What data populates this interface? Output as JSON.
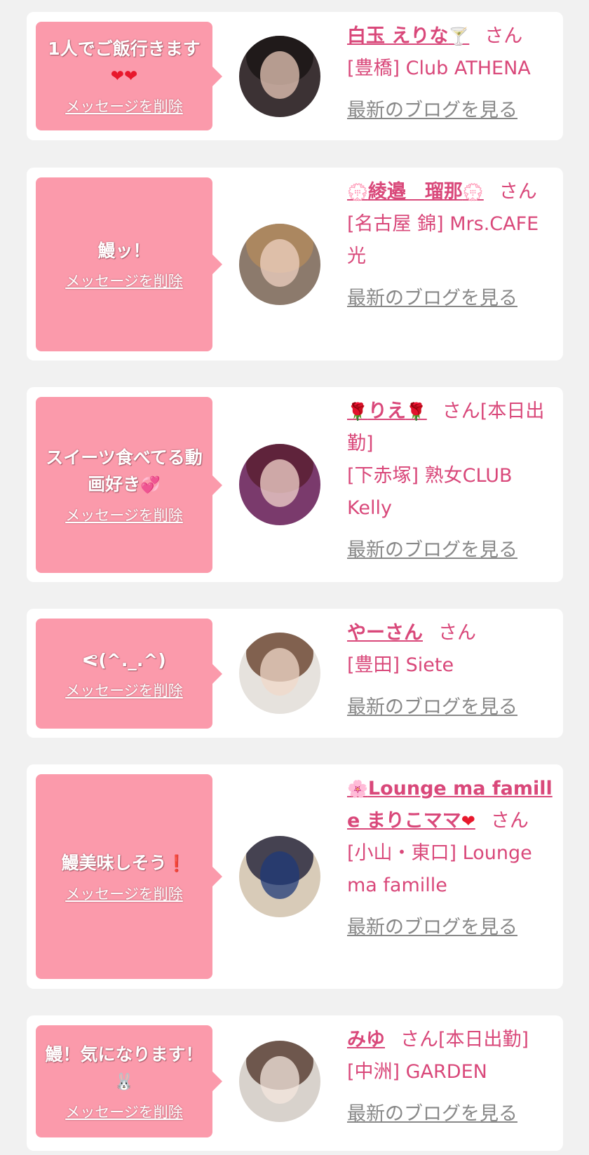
{
  "delete_label": "メッセージを削除",
  "blog_label": "最新のブログを見る",
  "honorific": "さん",
  "accent_color": "#d9487a",
  "bubble_color": "#fb9aab",
  "cards": [
    {
      "message": "1人でご飯行きます",
      "message_emoji": "❤❤",
      "name": "白玉 えりな",
      "name_emoji": "🍸",
      "suffix": "",
      "shop": "[豊橋] Club ATHENA"
    },
    {
      "message": "鰻ッ！",
      "message_emoji": "",
      "name": "綾邉　瑠那",
      "name_prefix_emoji": "💮",
      "name_emoji": "💮",
      "suffix": "",
      "shop": "[名古屋 錦] Mrs.CAFE 光"
    },
    {
      "message": "スイーツ食べてる動画好き",
      "message_emoji": "💞",
      "name": "りえ",
      "name_prefix_emoji": "🌹",
      "name_emoji": "🌹",
      "suffix": "[本日出勤]",
      "shop": "[下赤塚] 熟女CLUB Kelly"
    },
    {
      "message": "ᕙ(^._.^)",
      "message_emoji": "",
      "name": "やーさん",
      "name_emoji": "",
      "suffix": "",
      "shop": "[豊田] Siete"
    },
    {
      "message": "鰻美味しそう",
      "message_emoji": "❗",
      "name": "Lounge ma famille まりこママ",
      "name_prefix_emoji": "🌸",
      "name_emoji": "❤",
      "suffix": "",
      "shop": "[小山・東口] Lounge ma famille"
    },
    {
      "message": "鰻！気になります！",
      "message_emoji": "🐰",
      "name": "みゆ",
      "name_emoji": "",
      "suffix": "[本日出勤]",
      "shop": "[中洲] GARDEN"
    }
  ]
}
